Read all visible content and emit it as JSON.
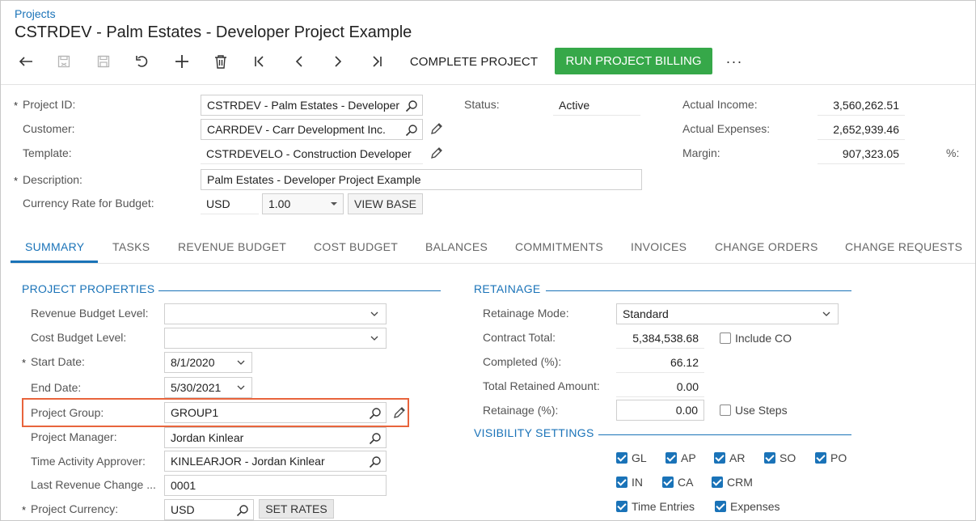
{
  "breadcrumb": "Projects",
  "title": "CSTRDEV - Palm Estates - Developer Project Example",
  "toolbar": {
    "complete_project": "COMPLETE PROJECT",
    "run_billing": "RUN PROJECT BILLING",
    "more": "···",
    "icons": [
      "back-arrow-icon",
      "save-close-icon",
      "save-icon",
      "undo-icon",
      "add-icon",
      "delete-icon",
      "first-record-icon",
      "previous-record-icon",
      "next-record-icon",
      "last-record-icon"
    ],
    "accent_color": "#36a849"
  },
  "summary": {
    "project_id_label": "Project ID:",
    "project_id": "CSTRDEV - Palm Estates - Developer",
    "customer_label": "Customer:",
    "customer": "CARRDEV - Carr Development Inc.",
    "template_label": "Template:",
    "template": "CSTRDEVELO - Construction Developer",
    "description_label": "Description:",
    "description": "Palm Estates - Developer Project Example",
    "currency_rate_label": "Currency Rate for Budget:",
    "currency": "USD",
    "rate": "1.00",
    "view_base": "VIEW BASE",
    "status_label": "Status:",
    "status": "Active",
    "actual_income_label": "Actual Income:",
    "actual_income": "3,560,262.51",
    "actual_expenses_label": "Actual Expenses:",
    "actual_expenses": "2,652,939.46",
    "margin_label": "Margin:",
    "margin": "907,323.05",
    "pct_label": "%:",
    "required_mark": "*"
  },
  "tabs": [
    "SUMMARY",
    "TASKS",
    "REVENUE BUDGET",
    "COST BUDGET",
    "BALANCES",
    "COMMITMENTS",
    "INVOICES",
    "CHANGE ORDERS",
    "CHANGE REQUESTS"
  ],
  "project_properties": {
    "title": "PROJECT PROPERTIES",
    "revenue_budget_level_label": "Revenue Budget Level:",
    "revenue_budget_level": "",
    "cost_budget_level_label": "Cost Budget Level:",
    "cost_budget_level": "",
    "start_date_label": "Start Date:",
    "start_date": "8/1/2020",
    "end_date_label": "End Date:",
    "end_date": "5/30/2021",
    "project_group_label": "Project Group:",
    "project_group": "GROUP1",
    "project_manager_label": "Project Manager:",
    "project_manager": "Jordan Kinlear",
    "time_activity_approver_label": "Time Activity Approver:",
    "time_activity_approver": "KINLEARJOR - Jordan Kinlear",
    "last_revenue_change_label": "Last Revenue Change ...",
    "last_revenue_change": "0001",
    "project_currency_label": "Project Currency:",
    "project_currency": "USD",
    "set_rates": "SET RATES",
    "highlight_color": "#e8643c"
  },
  "retainage": {
    "title": "RETAINAGE",
    "mode_label": "Retainage Mode:",
    "mode": "Standard",
    "contract_total_label": "Contract Total:",
    "contract_total": "5,384,538.68",
    "include_co_label": "Include CO",
    "include_co": false,
    "completed_label": "Completed (%):",
    "completed": "66.12",
    "total_retained_label": "Total Retained Amount:",
    "total_retained": "0.00",
    "retainage_pct_label": "Retainage (%):",
    "retainage_pct": "0.00",
    "use_steps_label": "Use Steps",
    "use_steps": false
  },
  "visibility": {
    "title": "VISIBILITY SETTINGS",
    "items": [
      {
        "label": "GL",
        "checked": true
      },
      {
        "label": "AP",
        "checked": true
      },
      {
        "label": "AR",
        "checked": true
      },
      {
        "label": "SO",
        "checked": true
      },
      {
        "label": "PO",
        "checked": true
      },
      {
        "label": "IN",
        "checked": true
      },
      {
        "label": "CA",
        "checked": true
      },
      {
        "label": "CRM",
        "checked": true
      },
      {
        "label": "Time Entries",
        "checked": true
      },
      {
        "label": "Expenses",
        "checked": true
      }
    ]
  }
}
